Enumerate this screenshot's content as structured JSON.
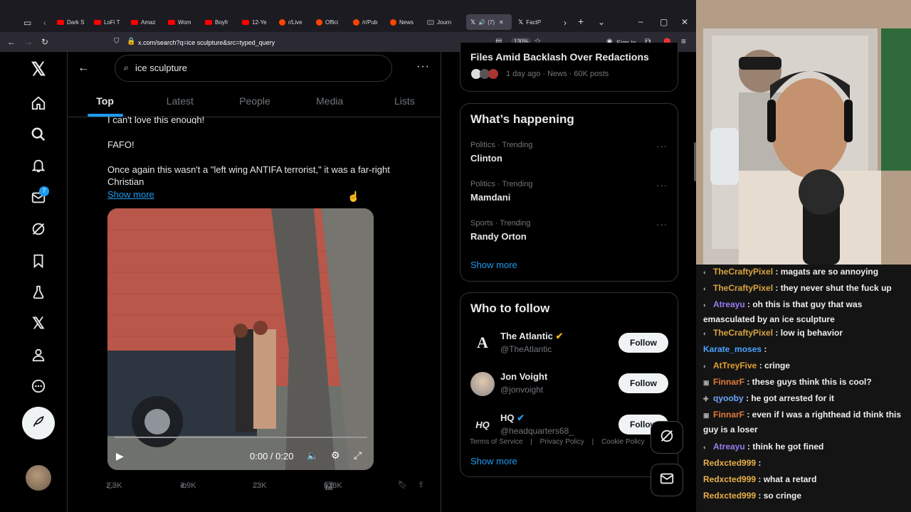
{
  "browser": {
    "tabs": [
      "Dark S",
      "LoFi T",
      "Amaz",
      "Wom",
      "Boyfr",
      "12-Ye",
      "r/Live",
      "Offici",
      "/r/Pub",
      "News",
      "Journ",
      "(7)",
      "FactP"
    ],
    "url": "x.com/search?q=ice sculpture&src=typed_query",
    "zoom": "130%",
    "sign_in": "Sign in"
  },
  "x": {
    "search_query": "ice sculpture",
    "notification_badge": "7",
    "tabs": [
      "Top",
      "Latest",
      "People",
      "Media",
      "Lists"
    ],
    "active_tab": "Top",
    "post": {
      "line1": "I can't love this enough!",
      "line2": "FAFO!",
      "line3": "Once again this wasn't a \"left wing ANTIFA terrorist,\" it was a far-right Christian",
      "show_more": "Show more",
      "video_time": "0:00 / 0:20",
      "replies": "2.3K",
      "reposts": "3.9K",
      "likes": "23K",
      "views": "628K"
    },
    "news_top": {
      "title": "Files Amid Backlash Over Redactions",
      "meta": "1 day ago · News · 60K posts"
    },
    "whats_happening": {
      "title": "What’s happening",
      "trends": [
        {
          "meta": "Politics · Trending",
          "name": "Clinton"
        },
        {
          "meta": "Politics · Trending",
          "name": "Mamdani"
        },
        {
          "meta": "Sports · Trending",
          "name": "Randy Orton"
        }
      ],
      "show_more": "Show more"
    },
    "who_to_follow": {
      "title": "Who to follow",
      "users": [
        {
          "name": "The Atlantic",
          "handle": "@TheAtlantic",
          "button": "Follow"
        },
        {
          "name": "Jon Voight",
          "handle": "@jonvoight",
          "button": "Follow"
        },
        {
          "name": "HQ",
          "handle": "@headquarters68_",
          "button": "Follow"
        }
      ],
      "show_more": "Show more"
    },
    "footer": {
      "terms": "Terms of Service",
      "privacy": "Privacy Policy",
      "cookie": "Cookie Policy",
      "sep": "|"
    }
  },
  "chat": [
    {
      "user": "TheCraftyPixel",
      "color": "#d9a441",
      "text": ": magats are so annoying"
    },
    {
      "user": "TheCraftyPixel",
      "color": "#d9a441",
      "text": ": they never shut the fuck up"
    },
    {
      "user": "Atreayu",
      "color": "#9b7cf0",
      "text": ": oh this is that guy that was emasculated by an ice sculpture"
    },
    {
      "user": "TheCraftyPixel",
      "color": "#d9a441",
      "text": ": low iq behavior"
    },
    {
      "user": "Karate_moses",
      "color": "#4aa3ff",
      "text": ":"
    },
    {
      "user": "AtTreyFive",
      "color": "#e0a030",
      "text": ": cringe"
    },
    {
      "user": "FinnarF",
      "color": "#e07b3a",
      "text": ": these guys think this is cool?"
    },
    {
      "user": "qyooby",
      "color": "#6aa7ff",
      "text": ": he got arrested for it"
    },
    {
      "user": "FinnarF",
      "color": "#e07b3a",
      "text": ": even if I was a righthead id think this guy is a loser"
    },
    {
      "user": "Atreayu",
      "color": "#9b7cf0",
      "text": ": think he got fined"
    },
    {
      "user": "Redxcted999",
      "color": "#e8b04a",
      "text": ":"
    },
    {
      "user": "Redxcted999",
      "color": "#e8b04a",
      "text": ": what a retard"
    },
    {
      "user": "Redxcted999",
      "color": "#e8b04a",
      "text": ": so cringe"
    }
  ]
}
